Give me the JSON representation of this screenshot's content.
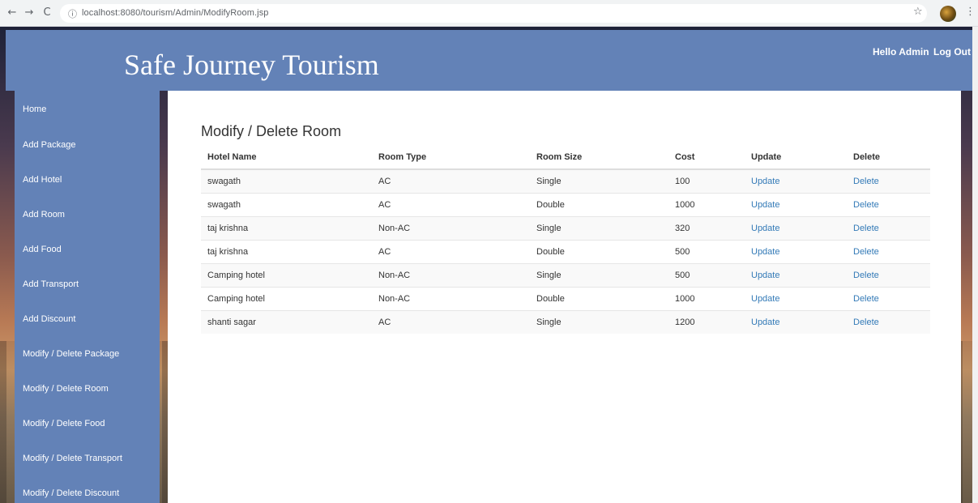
{
  "browser": {
    "url": "localhost:8080/tourism/Admin/ModifyRoom.jsp",
    "back_glyph": "←",
    "forward_glyph": "→",
    "reload_glyph": "C",
    "info_glyph": "ⓘ",
    "star_glyph": "☆",
    "menu_glyph": "⋮"
  },
  "header": {
    "site_title": "Safe Journey Tourism",
    "greeting": "Hello Admin",
    "logout_label": "Log Out",
    "color": "#6382b7"
  },
  "sidebar": {
    "items": [
      {
        "label": "Home"
      },
      {
        "label": "Add Package"
      },
      {
        "label": "Add Hotel"
      },
      {
        "label": "Add Room"
      },
      {
        "label": "Add Food"
      },
      {
        "label": "Add Transport"
      },
      {
        "label": "Add Discount"
      },
      {
        "label": "Modify / Delete Package"
      },
      {
        "label": "Modify / Delete Room"
      },
      {
        "label": "Modify / Delete Food"
      },
      {
        "label": "Modify / Delete Transport"
      },
      {
        "label": "Modify / Delete Discount"
      }
    ]
  },
  "main": {
    "title": "Modify / Delete Room",
    "columns": [
      "Hotel Name",
      "Room Type",
      "Room Size",
      "Cost",
      "Update",
      "Delete"
    ],
    "rows": [
      {
        "hotel": "swagath",
        "type": "AC",
        "size": "Single",
        "cost": "100",
        "update": "Update",
        "delete": "Delete"
      },
      {
        "hotel": "swagath",
        "type": "AC",
        "size": "Double",
        "cost": "1000",
        "update": "Update",
        "delete": "Delete"
      },
      {
        "hotel": "taj krishna",
        "type": "Non-AC",
        "size": "Single",
        "cost": "320",
        "update": "Update",
        "delete": "Delete"
      },
      {
        "hotel": "taj krishna",
        "type": "AC",
        "size": "Double",
        "cost": "500",
        "update": "Update",
        "delete": "Delete"
      },
      {
        "hotel": "Camping hotel",
        "type": "Non-AC",
        "size": "Single",
        "cost": "500",
        "update": "Update",
        "delete": "Delete"
      },
      {
        "hotel": "Camping hotel",
        "type": "Non-AC",
        "size": "Double",
        "cost": "1000",
        "update": "Update",
        "delete": "Delete"
      },
      {
        "hotel": "shanti sagar",
        "type": "AC",
        "size": "Single",
        "cost": "1200",
        "update": "Update",
        "delete": "Delete"
      }
    ],
    "link_color": "#337ab7"
  }
}
